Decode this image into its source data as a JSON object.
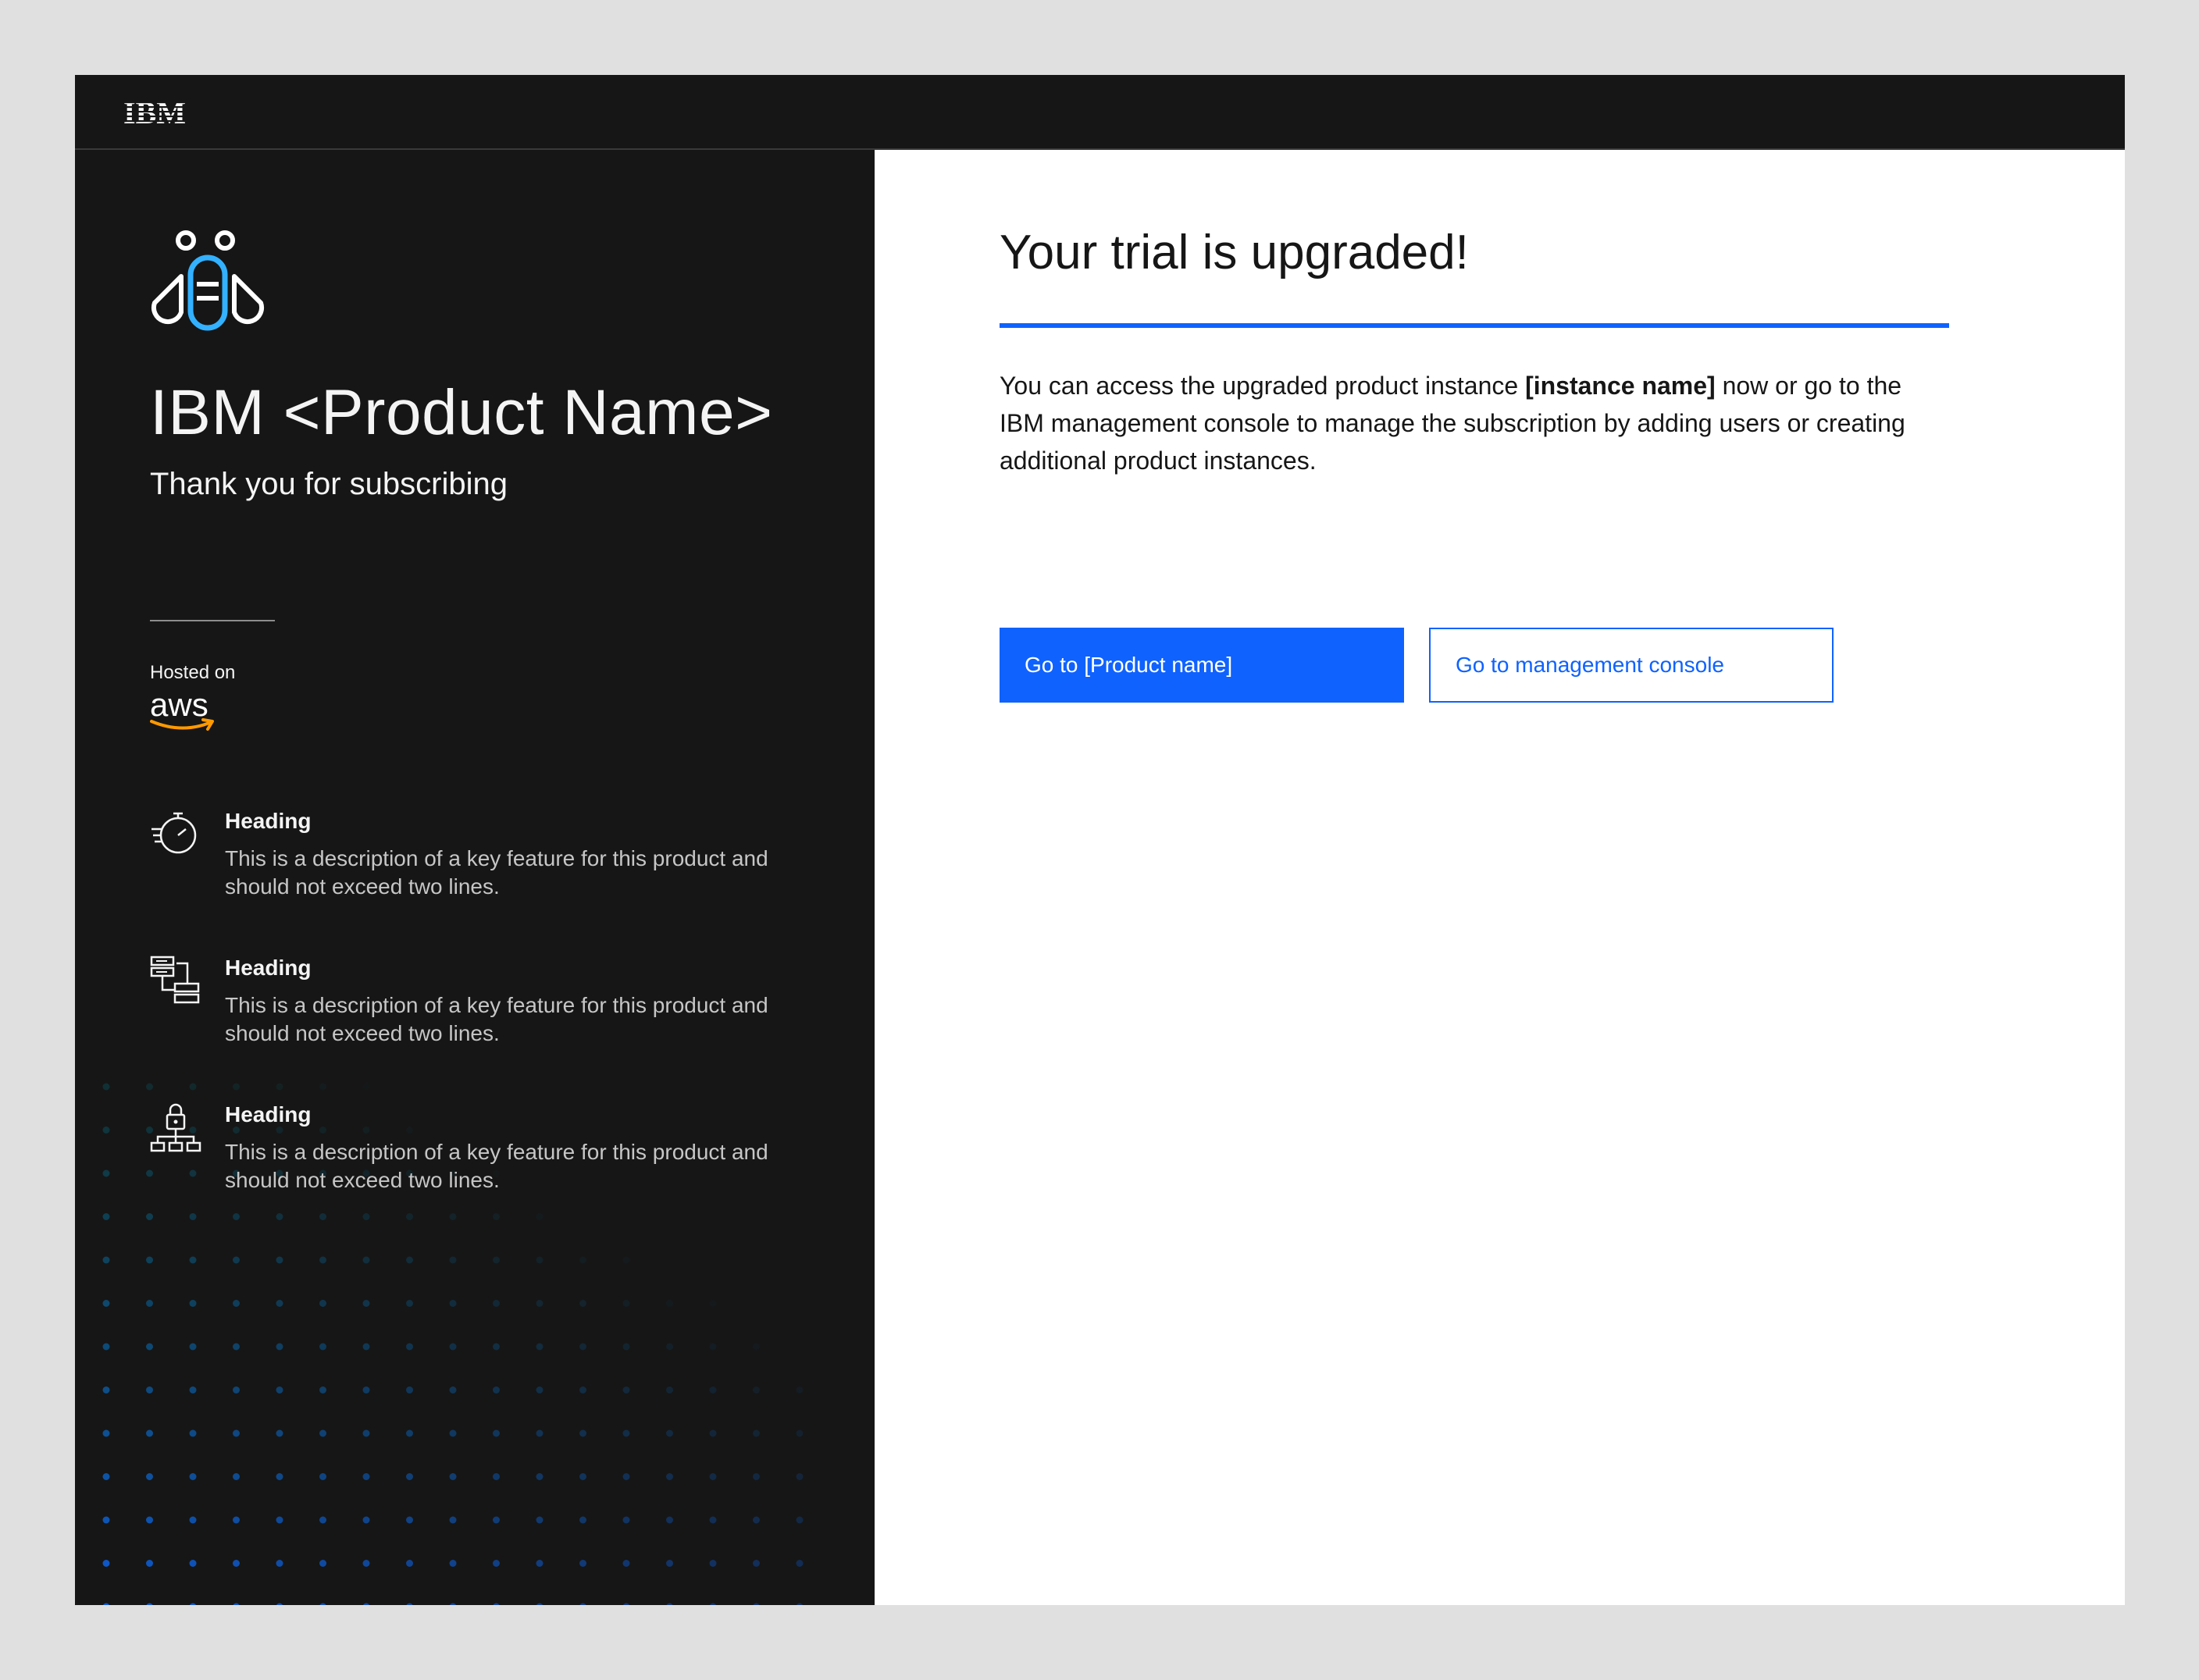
{
  "header": {
    "logo_text": "IBM",
    "logo_icon": "ibm-logo"
  },
  "left_panel": {
    "product_icon": "bee-icon",
    "product_title": "IBM <Product Name>",
    "subtitle": "Thank you for subscribing",
    "hosted_label": "Hosted on",
    "hosted_provider": "aws",
    "features": [
      {
        "icon": "stopwatch-speed-icon",
        "heading": "Heading",
        "description": "This is a description of a key feature for this product and should not exceed two lines."
      },
      {
        "icon": "data-structure-icon",
        "heading": "Heading",
        "description": "This is a description of a key feature for this product and should not exceed two lines."
      },
      {
        "icon": "lock-network-icon",
        "heading": "Heading",
        "description": "This is a description of a key feature for this product and should not exceed two lines."
      }
    ]
  },
  "main": {
    "title": "Your trial is upgraded!",
    "body_prefix": "You can access the upgraded product instance ",
    "body_bold": "[instance name]",
    "body_suffix": " now or go to the IBM management console to manage the subscription by adding users or creating additional product instances.",
    "primary_button": "Go to [Product name]",
    "secondary_button": "Go to management console"
  },
  "colors": {
    "accent": "#0f62fe",
    "dark_bg": "#161616",
    "page_bg": "#e0e0e0",
    "aws_orange": "#ff9900",
    "icon_cyan": "#33b1ff"
  }
}
